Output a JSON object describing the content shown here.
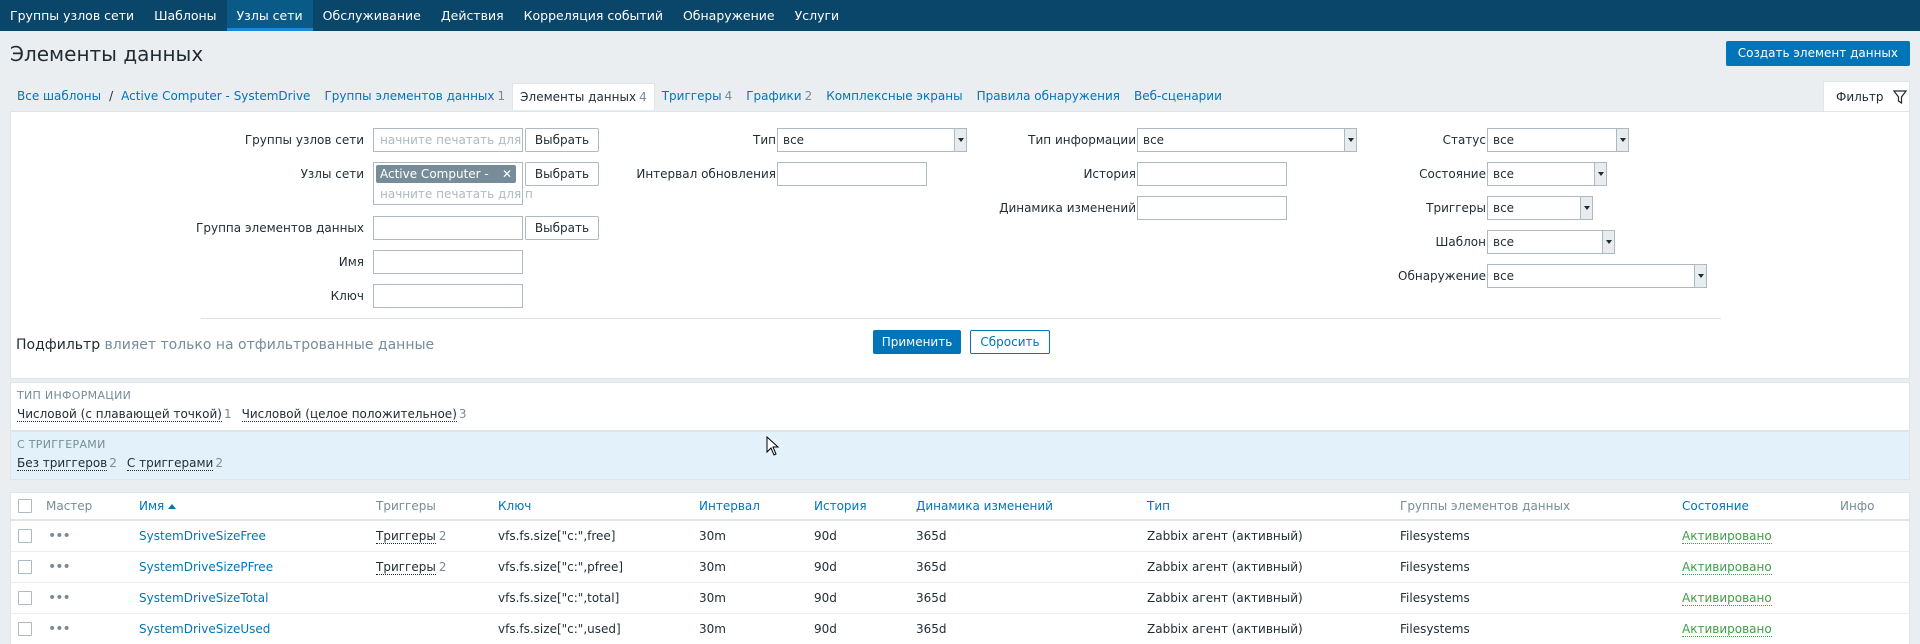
{
  "topnav": {
    "items": [
      "Группы узлов сети",
      "Шаблоны",
      "Узлы сети",
      "Обслуживание",
      "Действия",
      "Корреляция событий",
      "Обнаружение",
      "Услуги"
    ],
    "active_index": 2
  },
  "page": {
    "title": "Элементы данных",
    "create_button": "Создать элемент данных"
  },
  "breadcrumb": {
    "all_templates": "Все шаблоны",
    "host": "Active Computer - SystemDrive",
    "tabs": [
      {
        "label": "Группы элементов данных",
        "count": "1"
      },
      {
        "label": "Элементы данных",
        "count": "4"
      },
      {
        "label": "Триггеры",
        "count": "4"
      },
      {
        "label": "Графики",
        "count": "2"
      },
      {
        "label": "Комплексные экраны",
        "count": ""
      },
      {
        "label": "Правила обнаружения",
        "count": ""
      },
      {
        "label": "Веб-сценарии",
        "count": ""
      }
    ],
    "active_tab": 1
  },
  "filter": {
    "tab_label": "Фильтр",
    "host_groups_label": "Группы узлов сети",
    "host_groups_placeholder": "начните печатать для п",
    "hosts_label": "Узлы сети",
    "hosts_chip": "Active Computer - S...",
    "hosts_placeholder": "начните печатать для п",
    "app_label": "Группа элементов данных",
    "name_label": "Имя",
    "key_label": "Ключ",
    "select_button": "Выбрать",
    "type_label": "Тип",
    "type_value": "все",
    "interval_label": "Интервал обновления",
    "info_type_label": "Тип информации",
    "info_type_value": "все",
    "history_label": "История",
    "trends_label": "Динамика изменений",
    "status_label": "Статус",
    "status_value": "все",
    "state_label": "Состояние",
    "state_value": "все",
    "triggers_label": "Триггеры",
    "triggers_value": "все",
    "template_label": "Шаблон",
    "template_value": "все",
    "discovery_label": "Обнаружение",
    "discovery_value": "все",
    "apply_button": "Применить",
    "reset_button": "Сбросить"
  },
  "subfilter": {
    "title": "Подфильтр",
    "note": "влияет только на отфильтрованные данные",
    "groups": [
      {
        "title": "ТИП ИНФОРМАЦИИ",
        "items": [
          {
            "label": "Числовой (с плавающей точкой)",
            "count": "1"
          },
          {
            "label": "Числовой (целое положительное)",
            "count": "3"
          }
        ]
      },
      {
        "title": "С ТРИГГЕРАМИ",
        "items": [
          {
            "label": "Без триггеров",
            "count": "2"
          },
          {
            "label": "С триггерами",
            "count": "2"
          }
        ]
      }
    ]
  },
  "table": {
    "headers": {
      "master": "Мастер",
      "name": "Имя",
      "triggers": "Триггеры",
      "key": "Ключ",
      "interval": "Интервал",
      "history": "История",
      "trends": "Динамика изменений",
      "type": "Тип",
      "applications": "Группы элементов данных",
      "status": "Состояние",
      "info": "Инфо"
    },
    "rows": [
      {
        "name": "SystemDriveSizeFree",
        "triggers_label": "Триггеры",
        "triggers_count": "2",
        "key": "vfs.fs.size[\"c:\",free]",
        "interval": "30m",
        "history": "90d",
        "trends": "365d",
        "type": "Zabbix агент (активный)",
        "applications": "Filesystems",
        "status": "Активировано"
      },
      {
        "name": "SystemDriveSizePFree",
        "triggers_label": "Триггеры",
        "triggers_count": "2",
        "key": "vfs.fs.size[\"c:\",pfree]",
        "interval": "30m",
        "history": "90d",
        "trends": "365d",
        "type": "Zabbix агент (активный)",
        "applications": "Filesystems",
        "status": "Активировано"
      },
      {
        "name": "SystemDriveSizeTotal",
        "triggers_label": "",
        "triggers_count": "",
        "key": "vfs.fs.size[\"c:\",total]",
        "interval": "30m",
        "history": "90d",
        "trends": "365d",
        "type": "Zabbix агент (активный)",
        "applications": "Filesystems",
        "status": "Активировано"
      },
      {
        "name": "SystemDriveSizeUsed",
        "triggers_label": "",
        "triggers_count": "",
        "key": "vfs.fs.size[\"c:\",used]",
        "interval": "30m",
        "history": "90d",
        "trends": "365d",
        "type": "Zabbix агент (активный)",
        "applications": "Filesystems",
        "status": "Активировано"
      }
    ]
  },
  "colors": {
    "nav_bg": "#0a466a",
    "primary": "#0275b8",
    "status_enabled": "#429e47"
  }
}
